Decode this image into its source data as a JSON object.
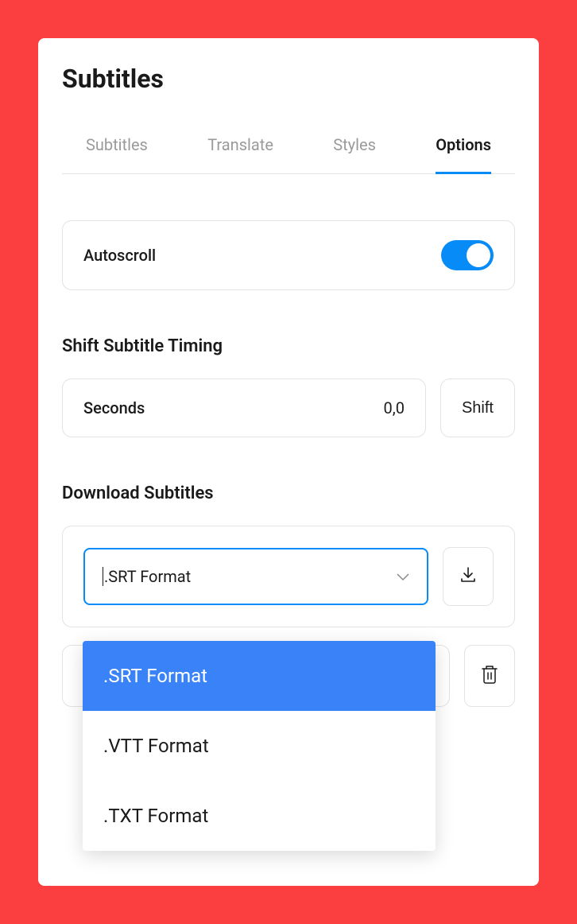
{
  "page_title": "Subtitles",
  "tabs": [
    {
      "label": "Subtitles",
      "active": false
    },
    {
      "label": "Translate",
      "active": false
    },
    {
      "label": "Styles",
      "active": false
    },
    {
      "label": "Options",
      "active": true
    }
  ],
  "autoscroll": {
    "label": "Autoscroll",
    "enabled": true
  },
  "shift": {
    "title": "Shift Subtitle Timing",
    "input_label": "Seconds",
    "input_value": "0,0",
    "button_label": "Shift"
  },
  "download": {
    "title": "Download Subtitles",
    "selected": ".SRT Format",
    "options": [
      ".SRT Format",
      ".VTT Format",
      ".TXT Format"
    ]
  }
}
